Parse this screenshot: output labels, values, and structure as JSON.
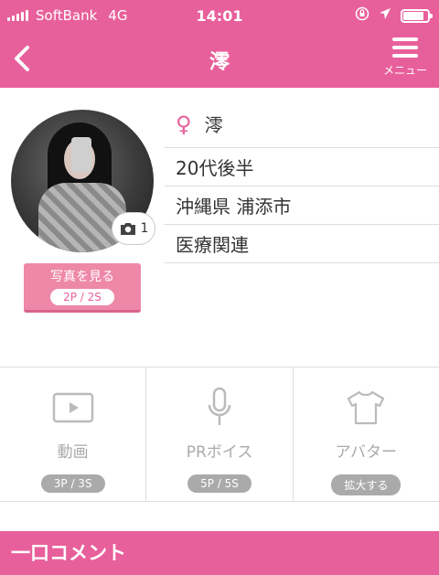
{
  "status_bar": {
    "carrier": "SoftBank",
    "network": "4G",
    "time": "14:01",
    "battery_level": 0.85
  },
  "nav": {
    "title": "澪",
    "menu_label": "メニュー"
  },
  "profile": {
    "photo_count": "1",
    "photo_button": {
      "label": "写真を見る",
      "cost": "2P / 2S"
    },
    "name": "澪",
    "age": "20代後半",
    "location": "沖縄県 浦添市",
    "job": "医療関連"
  },
  "features": [
    {
      "label": "動画",
      "cost": "3P / 3S",
      "icon": "video-icon"
    },
    {
      "label": "PRボイス",
      "cost": "5P / 5S",
      "icon": "microphone-icon"
    },
    {
      "label": "アバター",
      "cost": "拡大する",
      "icon": "shirt-icon"
    }
  ],
  "comment_section": {
    "title": "一口コメント"
  },
  "colors": {
    "accent": "#e8609b",
    "muted": "#aaaaaa"
  }
}
